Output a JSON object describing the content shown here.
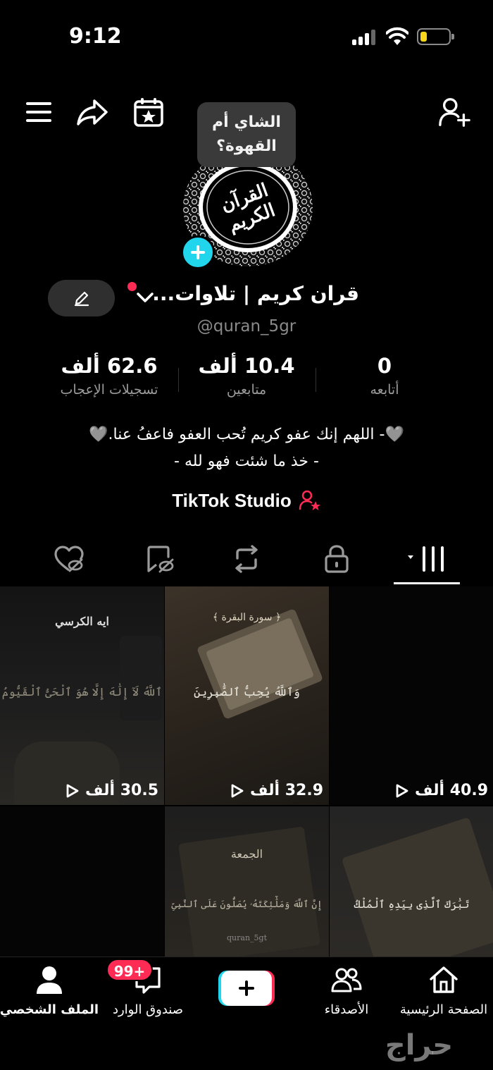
{
  "status": {
    "time": "9:12"
  },
  "profile": {
    "note": "الشاي أم القهوة؟",
    "display_name": "قران كريم | تلاوات...",
    "handle": "@quran_5gr",
    "avatar_text": "القرآن الكريم"
  },
  "stats": [
    {
      "num": "62.6 ألف",
      "label": "تسجيلات الإعجاب"
    },
    {
      "num": "10.4 ألف",
      "label": "متابعين"
    },
    {
      "num": "0",
      "label": "أتابعه"
    }
  ],
  "bio": {
    "line1": "🩶- اللهم إنك عفو كريم تُحب العفو فاعفُ عنا.🩶",
    "line2": "- خذ ما شئت فهو لله -"
  },
  "studio_label": "TikTok Studio",
  "videos": [
    {
      "views": "40.9 ألف",
      "text": ""
    },
    {
      "views": "32.9 ألف",
      "text": "وَٱللَّهُ يُحِبُّ ٱلصَّٰبِرِينَ"
    },
    {
      "views": "30.5 ألف",
      "title": "ايه الكرسي",
      "text": "ٱللَّهُ لَآ إِلَٰهَ إِلَّا هُوَ ٱلْحَىُّ ٱلْقَيُّومُ"
    },
    {
      "text": "تَبَٰرَكَ ٱلَّذِى بِيَدِهِ ٱلْمُلْكُ"
    },
    {
      "title": "الجمعة",
      "text": "إِنَّ ٱللَّهَ وَمَلَٰٓئِكَتَهُۥ يُصَلُّونَ عَلَى ٱلنَّبِىِّ",
      "handle": "quran_5gt"
    },
    {
      "text": ""
    }
  ],
  "nav": {
    "home": "الصفحة الرئيسية",
    "friends": "الأصدقاء",
    "inbox": "صندوق الوارد",
    "profile": "الملف الشخصي",
    "inbox_badge": "99+"
  },
  "watermark": "حراج",
  "colors": {
    "accent_pink": "#fe2c55",
    "accent_cyan": "#20d5ec"
  }
}
